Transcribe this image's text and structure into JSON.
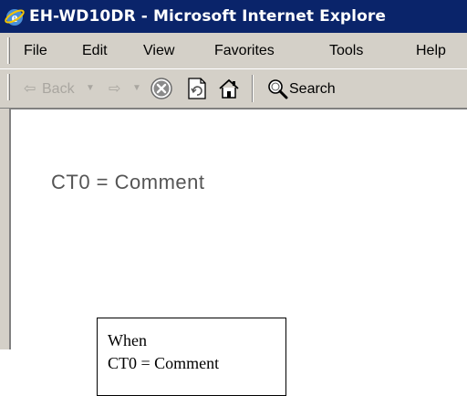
{
  "window": {
    "title": "EH-WD10DR - Microsoft Internet Explore"
  },
  "menubar": {
    "items": [
      "File",
      "Edit",
      "View",
      "Favorites",
      "Tools",
      "Help"
    ]
  },
  "toolbar": {
    "back_label": "Back",
    "search_label": "Search"
  },
  "content": {
    "text": "CT0 = Comment"
  },
  "callout": {
    "line1": "When",
    "line2": "CT0 = Comment"
  },
  "colors": {
    "titlebar": "#0a246a",
    "chrome": "#d4d0c8"
  }
}
